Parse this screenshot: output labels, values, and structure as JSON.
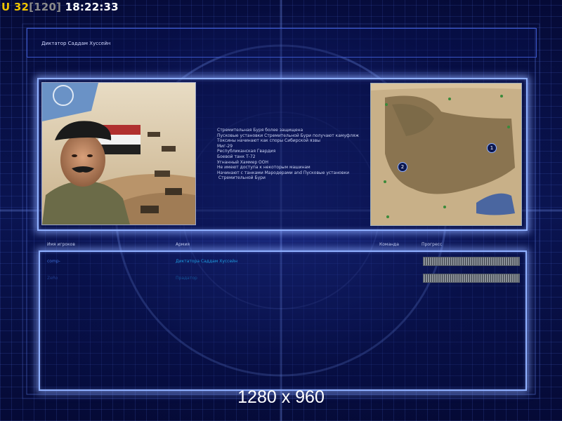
{
  "hud": {
    "prefix": "U",
    "fps": "32",
    "fps_max": "[120]",
    "clock": "18:22:33"
  },
  "mission": {
    "title": "Диктатор Саддам Хуссейн",
    "description": "Стремительная Буря более защищена\nПусковые установки Стремительной Бури получают камуфляж\nТоксины начинают как споры Сибирской язвы\nМиг-29\nРеспубликанская Гвардия\nБоевой танк Т-72\nУгнанный Хаммер ООН\nНе имеют доступа к некоторым машинам\nНачинают с танками Мародерами and Пусковые установки\n Стремительной Бури",
    "portrait_icon": "saddam-portrait",
    "minimap_icon": "desert-map-preview",
    "start_positions": [
      "1",
      "2"
    ]
  },
  "lobby": {
    "headers": {
      "player": "Имя игроков",
      "army": "Армия",
      "team": "Команда",
      "progress": "Прогресс"
    },
    "players": [
      {
        "name": "comp-",
        "army": "Диктатора Саддам Хуссейн",
        "progress": 1.0,
        "dim": false
      },
      {
        "name": "ZeRo",
        "army": "Прадатор",
        "progress": 1.0,
        "dim": true
      }
    ]
  },
  "overlay": {
    "resolution": "1280 x 960"
  },
  "colors": {
    "hud_prefix": "#f0c400",
    "frame_glow": "#8fb0ff",
    "player_name": "#3d6ed8",
    "army": "#1e9be0"
  }
}
